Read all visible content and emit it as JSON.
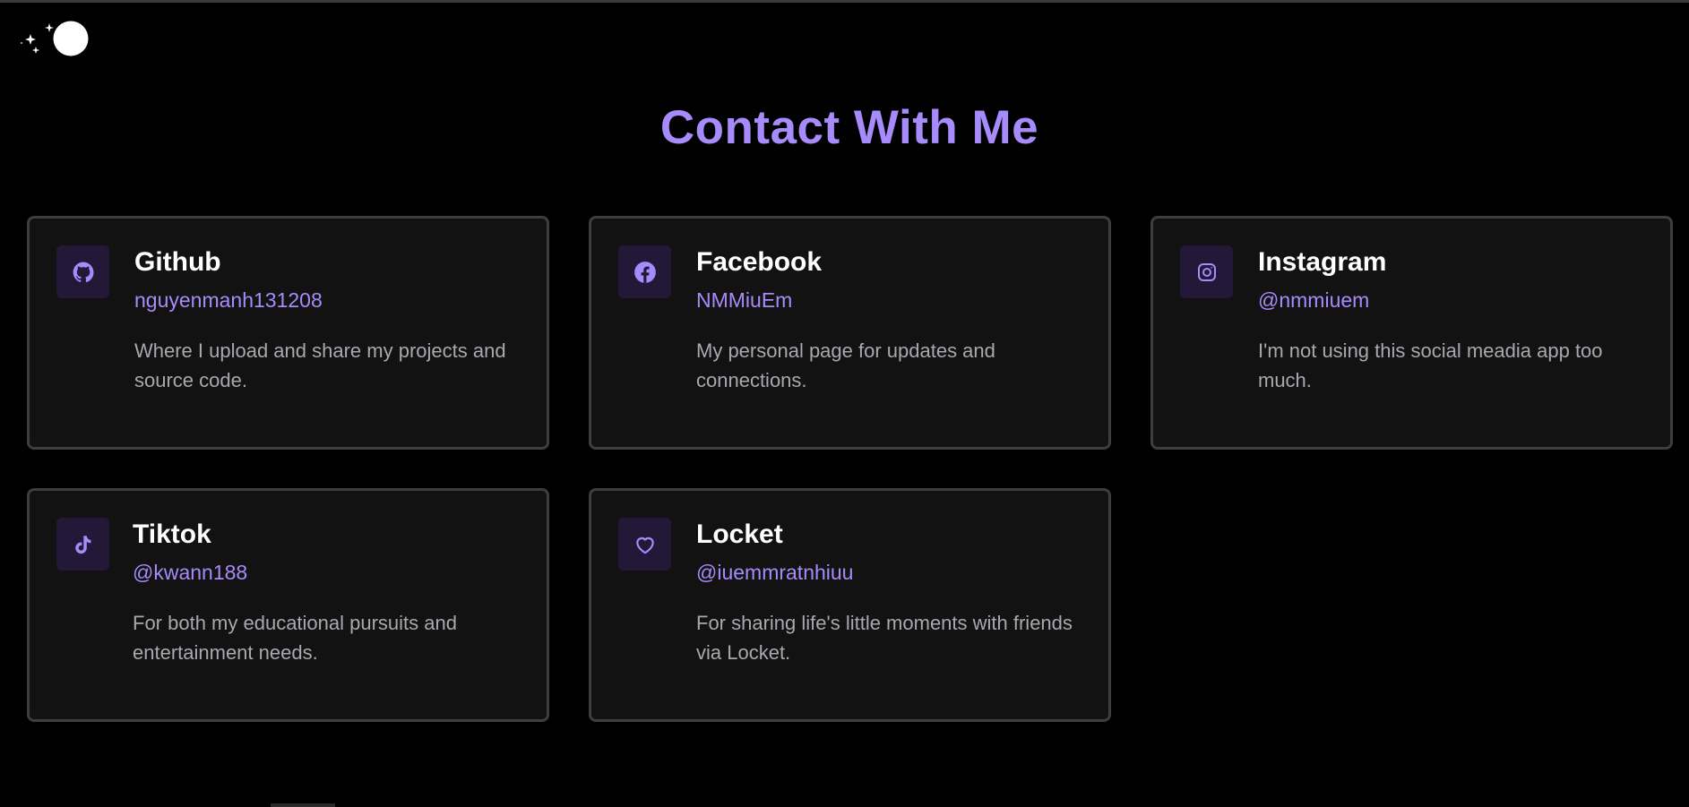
{
  "header": {
    "theme_toggle": "sun-moon-toggle"
  },
  "page": {
    "title": "Contact With Me"
  },
  "colors": {
    "accent": "#a78bfa",
    "background": "#000000",
    "card_bg": "#121212",
    "card_border": "#3d3d42",
    "icon_bg": "#241838",
    "text_primary": "#ffffff",
    "text_secondary": "#a8a8ae"
  },
  "contacts": [
    {
      "name": "Github",
      "handle": "nguyenmanh131208",
      "description": "Where I upload and share my projects and source code.",
      "icon": "github-icon"
    },
    {
      "name": "Facebook",
      "handle": "NMMiuEm",
      "description": "My personal page for updates and connections.",
      "icon": "facebook-icon"
    },
    {
      "name": "Instagram",
      "handle": "@nmmiuem",
      "description": "I'm not using this social meadia app too much.",
      "icon": "instagram-icon"
    },
    {
      "name": "Tiktok",
      "handle": "@kwann188",
      "description": "For both my educational pursuits and entertainment needs.",
      "icon": "tiktok-icon"
    },
    {
      "name": "Locket",
      "handle": "@iuemmratnhiuu",
      "description": "For sharing life's little moments with friends via Locket.",
      "icon": "heart-icon"
    }
  ]
}
